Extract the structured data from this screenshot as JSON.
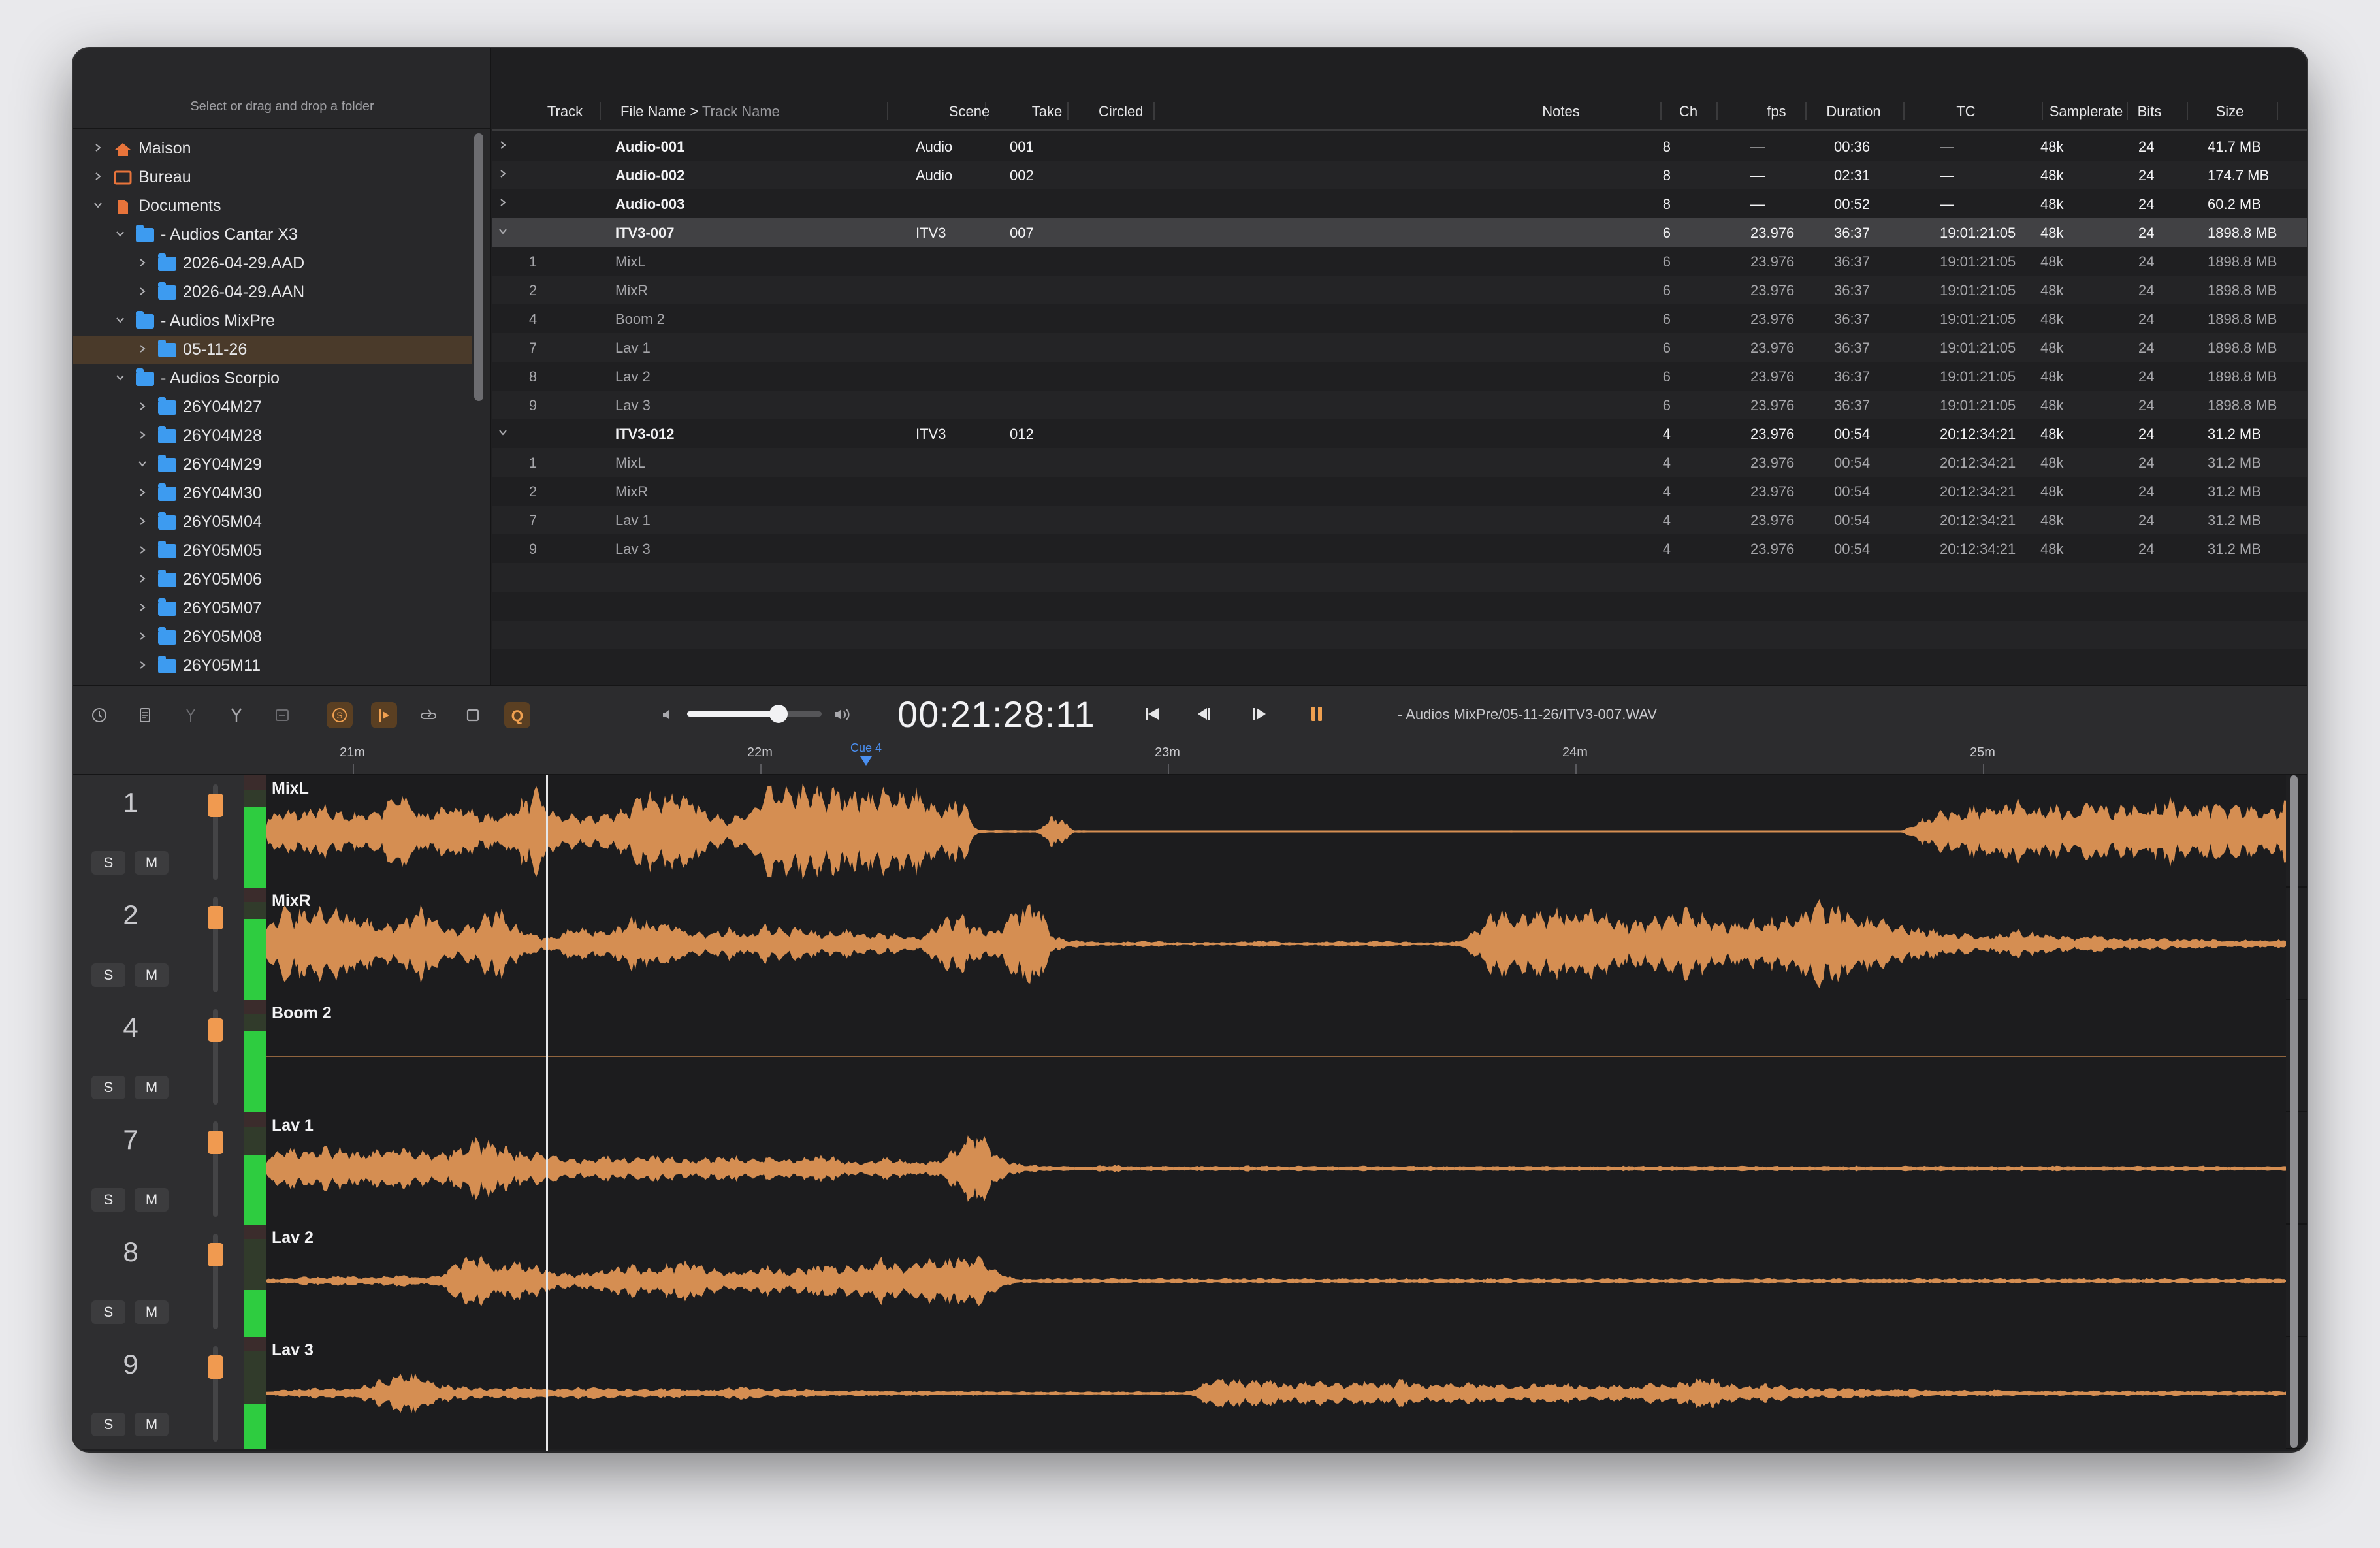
{
  "window": {
    "traffic_colors": [
      "#ff5f57",
      "#febc2e",
      "#28c840"
    ]
  },
  "sidebar": {
    "hint": "Select or drag and drop a folder",
    "items": [
      {
        "label": "Maison",
        "level": 0,
        "expanded": false,
        "icon": "home-icon",
        "icon_color": "#e8743b"
      },
      {
        "label": "Bureau",
        "level": 0,
        "expanded": false,
        "icon": "desktop-icon",
        "icon_color": "#e8743b"
      },
      {
        "label": "Documents",
        "level": 0,
        "expanded": true,
        "icon": "document-folder-icon",
        "icon_color": "#e8743b"
      },
      {
        "label": "- Audios Cantar X3",
        "level": 1,
        "expanded": true,
        "icon": "folder-icon"
      },
      {
        "label": "2026-04-29.AAD",
        "level": 2,
        "expanded": false,
        "icon": "folder-icon"
      },
      {
        "label": "2026-04-29.AAN",
        "level": 2,
        "expanded": false,
        "icon": "folder-icon"
      },
      {
        "label": "- Audios MixPre",
        "level": 1,
        "expanded": true,
        "icon": "folder-icon"
      },
      {
        "label": "05-11-26",
        "level": 2,
        "expanded": false,
        "icon": "folder-icon",
        "selected": true
      },
      {
        "label": "- Audios Scorpio",
        "level": 1,
        "expanded": true,
        "icon": "folder-icon"
      },
      {
        "label": "26Y04M27",
        "level": 2,
        "expanded": false,
        "icon": "folder-icon"
      },
      {
        "label": "26Y04M28",
        "level": 2,
        "expanded": false,
        "icon": "folder-icon"
      },
      {
        "label": "26Y04M29",
        "level": 2,
        "expanded": true,
        "icon": "folder-icon"
      },
      {
        "label": "26Y04M30",
        "level": 2,
        "expanded": false,
        "icon": "folder-icon"
      },
      {
        "label": "26Y05M04",
        "level": 2,
        "expanded": false,
        "icon": "folder-icon"
      },
      {
        "label": "26Y05M05",
        "level": 2,
        "expanded": false,
        "icon": "folder-icon"
      },
      {
        "label": "26Y05M06",
        "level": 2,
        "expanded": false,
        "icon": "folder-icon"
      },
      {
        "label": "26Y05M07",
        "level": 2,
        "expanded": false,
        "icon": "folder-icon"
      },
      {
        "label": "26Y05M08",
        "level": 2,
        "expanded": false,
        "icon": "folder-icon"
      },
      {
        "label": "26Y05M11",
        "level": 2,
        "expanded": false,
        "icon": "folder-icon"
      }
    ]
  },
  "table": {
    "columns": [
      {
        "key": "track",
        "label": "Track"
      },
      {
        "key": "file",
        "label": "File Name >",
        "label_secondary": "Track Name"
      },
      {
        "key": "scene",
        "label": "Scene"
      },
      {
        "key": "take",
        "label": "Take"
      },
      {
        "key": "circled",
        "label": "Circled"
      },
      {
        "key": "notes",
        "label": "Notes"
      },
      {
        "key": "ch",
        "label": "Ch"
      },
      {
        "key": "fps",
        "label": "fps"
      },
      {
        "key": "duration",
        "label": "Duration"
      },
      {
        "key": "tc",
        "label": "TC"
      },
      {
        "key": "samplerate",
        "label": "Samplerate"
      },
      {
        "key": "bits",
        "label": "Bits"
      },
      {
        "key": "size",
        "label": "Size"
      }
    ],
    "rows": [
      {
        "kind": "parent",
        "expanded": false,
        "track": "",
        "file": "Audio-001",
        "scene": "Audio",
        "take": "001",
        "circled": "",
        "notes": "",
        "ch": "8",
        "fps": "—",
        "duration": "00:36",
        "tc": "—",
        "samplerate": "48k",
        "bits": "24",
        "size": "41.7 MB"
      },
      {
        "kind": "parent",
        "expanded": false,
        "track": "",
        "file": "Audio-002",
        "scene": "Audio",
        "take": "002",
        "circled": "",
        "notes": "",
        "ch": "8",
        "fps": "—",
        "duration": "02:31",
        "tc": "—",
        "samplerate": "48k",
        "bits": "24",
        "size": "174.7 MB"
      },
      {
        "kind": "parent",
        "expanded": false,
        "track": "",
        "file": "Audio-003",
        "scene": "",
        "take": "",
        "circled": "",
        "notes": "",
        "ch": "8",
        "fps": "—",
        "duration": "00:52",
        "tc": "—",
        "samplerate": "48k",
        "bits": "24",
        "size": "60.2 MB"
      },
      {
        "kind": "parent",
        "expanded": true,
        "selected": true,
        "track": "",
        "file": "ITV3-007",
        "scene": "ITV3",
        "take": "007",
        "circled": "",
        "notes": "",
        "ch": "6",
        "fps": "23.976",
        "duration": "36:37",
        "tc": "19:01:21:05",
        "samplerate": "48k",
        "bits": "24",
        "size": "1898.8 MB"
      },
      {
        "kind": "child",
        "track": "1",
        "file": "MixL",
        "scene": "",
        "take": "",
        "circled": "",
        "notes": "",
        "ch": "6",
        "fps": "23.976",
        "duration": "36:37",
        "tc": "19:01:21:05",
        "samplerate": "48k",
        "bits": "24",
        "size": "1898.8 MB"
      },
      {
        "kind": "child",
        "track": "2",
        "file": "MixR",
        "scene": "",
        "take": "",
        "circled": "",
        "notes": "",
        "ch": "6",
        "fps": "23.976",
        "duration": "36:37",
        "tc": "19:01:21:05",
        "samplerate": "48k",
        "bits": "24",
        "size": "1898.8 MB"
      },
      {
        "kind": "child",
        "track": "4",
        "file": "Boom 2",
        "scene": "",
        "take": "",
        "circled": "",
        "notes": "",
        "ch": "6",
        "fps": "23.976",
        "duration": "36:37",
        "tc": "19:01:21:05",
        "samplerate": "48k",
        "bits": "24",
        "size": "1898.8 MB"
      },
      {
        "kind": "child",
        "track": "7",
        "file": "Lav 1",
        "scene": "",
        "take": "",
        "circled": "",
        "notes": "",
        "ch": "6",
        "fps": "23.976",
        "duration": "36:37",
        "tc": "19:01:21:05",
        "samplerate": "48k",
        "bits": "24",
        "size": "1898.8 MB"
      },
      {
        "kind": "child",
        "track": "8",
        "file": "Lav 2",
        "scene": "",
        "take": "",
        "circled": "",
        "notes": "",
        "ch": "6",
        "fps": "23.976",
        "duration": "36:37",
        "tc": "19:01:21:05",
        "samplerate": "48k",
        "bits": "24",
        "size": "1898.8 MB"
      },
      {
        "kind": "child",
        "track": "9",
        "file": "Lav 3",
        "scene": "",
        "take": "",
        "circled": "",
        "notes": "",
        "ch": "6",
        "fps": "23.976",
        "duration": "36:37",
        "tc": "19:01:21:05",
        "samplerate": "48k",
        "bits": "24",
        "size": "1898.8 MB"
      },
      {
        "kind": "parent",
        "expanded": true,
        "track": "",
        "file": "ITV3-012",
        "scene": "ITV3",
        "take": "012",
        "circled": "",
        "notes": "",
        "ch": "4",
        "fps": "23.976",
        "duration": "00:54",
        "tc": "20:12:34:21",
        "samplerate": "48k",
        "bits": "24",
        "size": "31.2 MB"
      },
      {
        "kind": "child",
        "track": "1",
        "file": "MixL",
        "scene": "",
        "take": "",
        "circled": "",
        "notes": "",
        "ch": "4",
        "fps": "23.976",
        "duration": "00:54",
        "tc": "20:12:34:21",
        "samplerate": "48k",
        "bits": "24",
        "size": "31.2 MB"
      },
      {
        "kind": "child",
        "track": "2",
        "file": "MixR",
        "scene": "",
        "take": "",
        "circled": "",
        "notes": "",
        "ch": "4",
        "fps": "23.976",
        "duration": "00:54",
        "tc": "20:12:34:21",
        "samplerate": "48k",
        "bits": "24",
        "size": "31.2 MB"
      },
      {
        "kind": "child",
        "track": "7",
        "file": "Lav 1",
        "scene": "",
        "take": "",
        "circled": "",
        "notes": "",
        "ch": "4",
        "fps": "23.976",
        "duration": "00:54",
        "tc": "20:12:34:21",
        "samplerate": "48k",
        "bits": "24",
        "size": "31.2 MB"
      },
      {
        "kind": "child",
        "track": "9",
        "file": "Lav 3",
        "scene": "",
        "take": "",
        "circled": "",
        "notes": "",
        "ch": "4",
        "fps": "23.976",
        "duration": "00:54",
        "tc": "20:12:34:21",
        "samplerate": "48k",
        "bits": "24",
        "size": "31.2 MB"
      }
    ]
  },
  "transport": {
    "tools": [
      "clock-icon",
      "notes-icon",
      "split-icon",
      "merge-icon",
      "minus-box-icon"
    ],
    "modes": [
      {
        "icon": "solo-s-icon",
        "active": true
      },
      {
        "icon": "play-from-cursor-icon",
        "active": true
      },
      {
        "icon": "loop-icon",
        "active": false
      },
      {
        "icon": "square-icon",
        "active": false
      },
      {
        "icon": "quick-q-icon",
        "active": true,
        "glyph": "Q"
      }
    ],
    "volume": 0.68,
    "timecode": "00:21:28:11",
    "buttons": [
      "skip-to-start-icon",
      "step-back-icon",
      "step-forward-icon",
      "pause-icon"
    ],
    "file_path": "- Audios MixPre/05-11-26/ITV3-007.WAV"
  },
  "ruler": {
    "labels": [
      "21m",
      "22m",
      "23m",
      "24m",
      "25m"
    ],
    "cue_label": "Cue 4",
    "accent_color": "#4a8ff0"
  },
  "tracks": [
    {
      "number": "1",
      "name": "MixL",
      "solo": "S",
      "mute": "M",
      "fader": 0.87,
      "meter": 0.72,
      "profile": [
        0.35,
        0.5,
        0.45,
        0.6,
        0.4,
        0.45,
        0.55,
        0.95,
        0.45,
        0.5,
        0.7,
        0.4,
        0.35,
        0.6,
        0.95,
        0.4,
        0.35,
        0.35,
        0.45,
        0.6,
        0.95,
        0.9,
        0.85,
        0.45,
        0.3,
        0.4,
        0.95,
        0.95,
        0.98,
        0.95,
        0.95,
        0.95,
        0.9,
        0.95,
        0.9,
        0.45,
        0.8,
        0.05,
        0.03,
        0.03,
        0.03,
        0.4,
        0.03,
        0.02,
        0.02,
        0.02,
        0.02,
        0.02,
        0.02,
        0.02,
        0.02,
        0.02,
        0.02,
        0.02,
        0.02,
        0.02,
        0.02,
        0.02,
        0.02,
        0.02,
        0.02,
        0.02,
        0.02,
        0.02,
        0.02,
        0.02,
        0.02,
        0.02,
        0.02,
        0.02,
        0.02,
        0.02,
        0.02,
        0.02,
        0.02,
        0.02,
        0.02,
        0.02,
        0.02,
        0.02,
        0.02,
        0.02,
        0.02,
        0.02,
        0.02,
        0.02,
        0.25,
        0.5,
        0.45,
        0.6,
        0.55,
        0.8,
        0.5,
        0.6,
        0.45,
        0.7,
        0.5,
        0.65,
        0.55,
        0.75,
        0.5,
        0.7,
        0.55,
        0.6,
        0.55,
        0.65
      ]
    },
    {
      "number": "2",
      "name": "MixR",
      "solo": "S",
      "mute": "M",
      "fader": 0.87,
      "meter": 0.72,
      "profile": [
        0.5,
        0.8,
        0.75,
        0.85,
        0.8,
        0.55,
        0.45,
        0.6,
        0.9,
        0.5,
        0.3,
        0.55,
        0.8,
        0.4,
        0.2,
        0.15,
        0.4,
        0.3,
        0.3,
        0.6,
        0.45,
        0.5,
        0.3,
        0.25,
        0.4,
        0.2,
        0.45,
        0.3,
        0.4,
        0.2,
        0.35,
        0.2,
        0.25,
        0.2,
        0.15,
        0.5,
        0.7,
        0.4,
        0.3,
        0.85,
        0.95,
        0.15,
        0.08,
        0.05,
        0.04,
        0.05,
        0.08,
        0.04,
        0.04,
        0.04,
        0.04,
        0.06,
        0.08,
        0.04,
        0.04,
        0.05,
        0.06,
        0.05,
        0.08,
        0.05,
        0.04,
        0.05,
        0.06,
        0.4,
        0.85,
        0.6,
        0.75,
        0.8,
        0.7,
        0.9,
        0.65,
        0.5,
        0.55,
        0.6,
        0.8,
        0.55,
        0.45,
        0.5,
        0.55,
        0.65,
        0.75,
        0.95,
        0.85,
        0.6,
        0.55,
        0.45,
        0.35,
        0.3,
        0.25,
        0.2,
        0.2,
        0.3,
        0.25,
        0.2,
        0.15,
        0.2,
        0.15,
        0.12,
        0.15,
        0.1,
        0.12,
        0.1,
        0.08,
        0.1,
        0.08,
        0.1
      ]
    },
    {
      "number": "4",
      "name": "Boom 2",
      "solo": "S",
      "mute": "M",
      "fader": 0.87,
      "meter": 0.72,
      "profile": [
        0.008
      ]
    },
    {
      "number": "7",
      "name": "Lav 1",
      "solo": "S",
      "mute": "M",
      "fader": 0.87,
      "meter": 0.62,
      "profile": [
        0.3,
        0.45,
        0.4,
        0.45,
        0.5,
        0.35,
        0.45,
        0.5,
        0.4,
        0.35,
        0.45,
        0.7,
        0.55,
        0.4,
        0.35,
        0.3,
        0.2,
        0.25,
        0.3,
        0.2,
        0.3,
        0.25,
        0.2,
        0.25,
        0.3,
        0.2,
        0.25,
        0.2,
        0.25,
        0.3,
        0.2,
        0.15,
        0.25,
        0.2,
        0.15,
        0.2,
        0.5,
        0.95,
        0.3,
        0.12,
        0.08,
        0.06,
        0.05,
        0.06,
        0.08,
        0.05,
        0.06,
        0.05,
        0.05,
        0.06,
        0.05,
        0.06,
        0.06,
        0.05,
        0.06,
        0.06,
        0.05,
        0.06,
        0.05,
        0.06,
        0.06,
        0.05,
        0.06,
        0.05,
        0.06,
        0.05,
        0.06,
        0.05,
        0.06,
        0.05,
        0.06,
        0.06,
        0.05,
        0.06,
        0.05,
        0.06,
        0.05,
        0.06,
        0.05,
        0.06,
        0.05,
        0.06,
        0.05,
        0.06,
        0.05,
        0.06,
        0.05,
        0.06,
        0.05,
        0.06,
        0.05,
        0.06,
        0.05,
        0.06,
        0.05,
        0.06,
        0.05,
        0.06,
        0.05,
        0.06,
        0.05,
        0.06,
        0.05,
        0.05,
        0.05,
        0.05
      ]
    },
    {
      "number": "8",
      "name": "Lav 2",
      "solo": "S",
      "mute": "M",
      "fader": 0.87,
      "meter": 0.42,
      "profile": [
        0.05,
        0.06,
        0.1,
        0.08,
        0.12,
        0.08,
        0.1,
        0.15,
        0.08,
        0.12,
        0.5,
        0.6,
        0.3,
        0.45,
        0.35,
        0.2,
        0.15,
        0.2,
        0.3,
        0.35,
        0.25,
        0.4,
        0.45,
        0.3,
        0.2,
        0.25,
        0.35,
        0.2,
        0.3,
        0.4,
        0.3,
        0.35,
        0.5,
        0.3,
        0.45,
        0.5,
        0.55,
        0.6,
        0.2,
        0.05,
        0.05,
        0.06,
        0.06,
        0.05,
        0.06,
        0.05,
        0.06,
        0.05,
        0.06,
        0.05,
        0.06,
        0.05,
        0.06,
        0.05,
        0.06,
        0.05,
        0.06,
        0.05,
        0.06,
        0.05,
        0.06,
        0.05,
        0.06,
        0.05,
        0.06,
        0.05,
        0.06,
        0.05,
        0.06,
        0.05,
        0.06,
        0.05,
        0.06,
        0.05,
        0.06,
        0.05,
        0.06,
        0.05,
        0.06,
        0.05,
        0.06,
        0.05,
        0.06,
        0.05,
        0.06,
        0.05,
        0.06,
        0.05,
        0.06,
        0.05,
        0.06,
        0.05,
        0.06,
        0.05,
        0.06,
        0.05,
        0.06,
        0.05,
        0.06,
        0.05,
        0.06,
        0.06,
        0.05,
        0.06,
        0.06,
        0.05
      ]
    },
    {
      "number": "9",
      "name": "Lav 3",
      "solo": "S",
      "mute": "M",
      "fader": 0.87,
      "meter": 0.4,
      "profile": [
        0.05,
        0.08,
        0.1,
        0.12,
        0.1,
        0.15,
        0.3,
        0.45,
        0.4,
        0.2,
        0.15,
        0.12,
        0.1,
        0.15,
        0.12,
        0.1,
        0.12,
        0.15,
        0.1,
        0.08,
        0.1,
        0.12,
        0.1,
        0.08,
        0.12,
        0.15,
        0.1,
        0.08,
        0.1,
        0.08,
        0.06,
        0.08,
        0.06,
        0.05,
        0.06,
        0.05,
        0.06,
        0.05,
        0.05,
        0.04,
        0.04,
        0.04,
        0.04,
        0.04,
        0.04,
        0.04,
        0.04,
        0.04,
        0.04,
        0.3,
        0.35,
        0.25,
        0.3,
        0.2,
        0.25,
        0.3,
        0.2,
        0.3,
        0.2,
        0.3,
        0.2,
        0.25,
        0.2,
        0.25,
        0.2,
        0.15,
        0.2,
        0.25,
        0.2,
        0.15,
        0.2,
        0.15,
        0.25,
        0.2,
        0.3,
        0.35,
        0.2,
        0.15,
        0.2,
        0.15,
        0.12,
        0.1,
        0.12,
        0.1,
        0.08,
        0.1,
        0.08,
        0.06,
        0.08,
        0.06,
        0.08,
        0.06,
        0.05,
        0.06,
        0.05,
        0.06,
        0.05,
        0.06,
        0.05,
        0.06,
        0.05,
        0.06,
        0.05,
        0.06,
        0.05,
        0.06
      ]
    }
  ],
  "colors": {
    "accent": "#f09a50",
    "waveform": "#d58e52",
    "meter_green": "#2ecc40",
    "cue_blue": "#4a8ff0",
    "selection": "#4a3a2a"
  }
}
